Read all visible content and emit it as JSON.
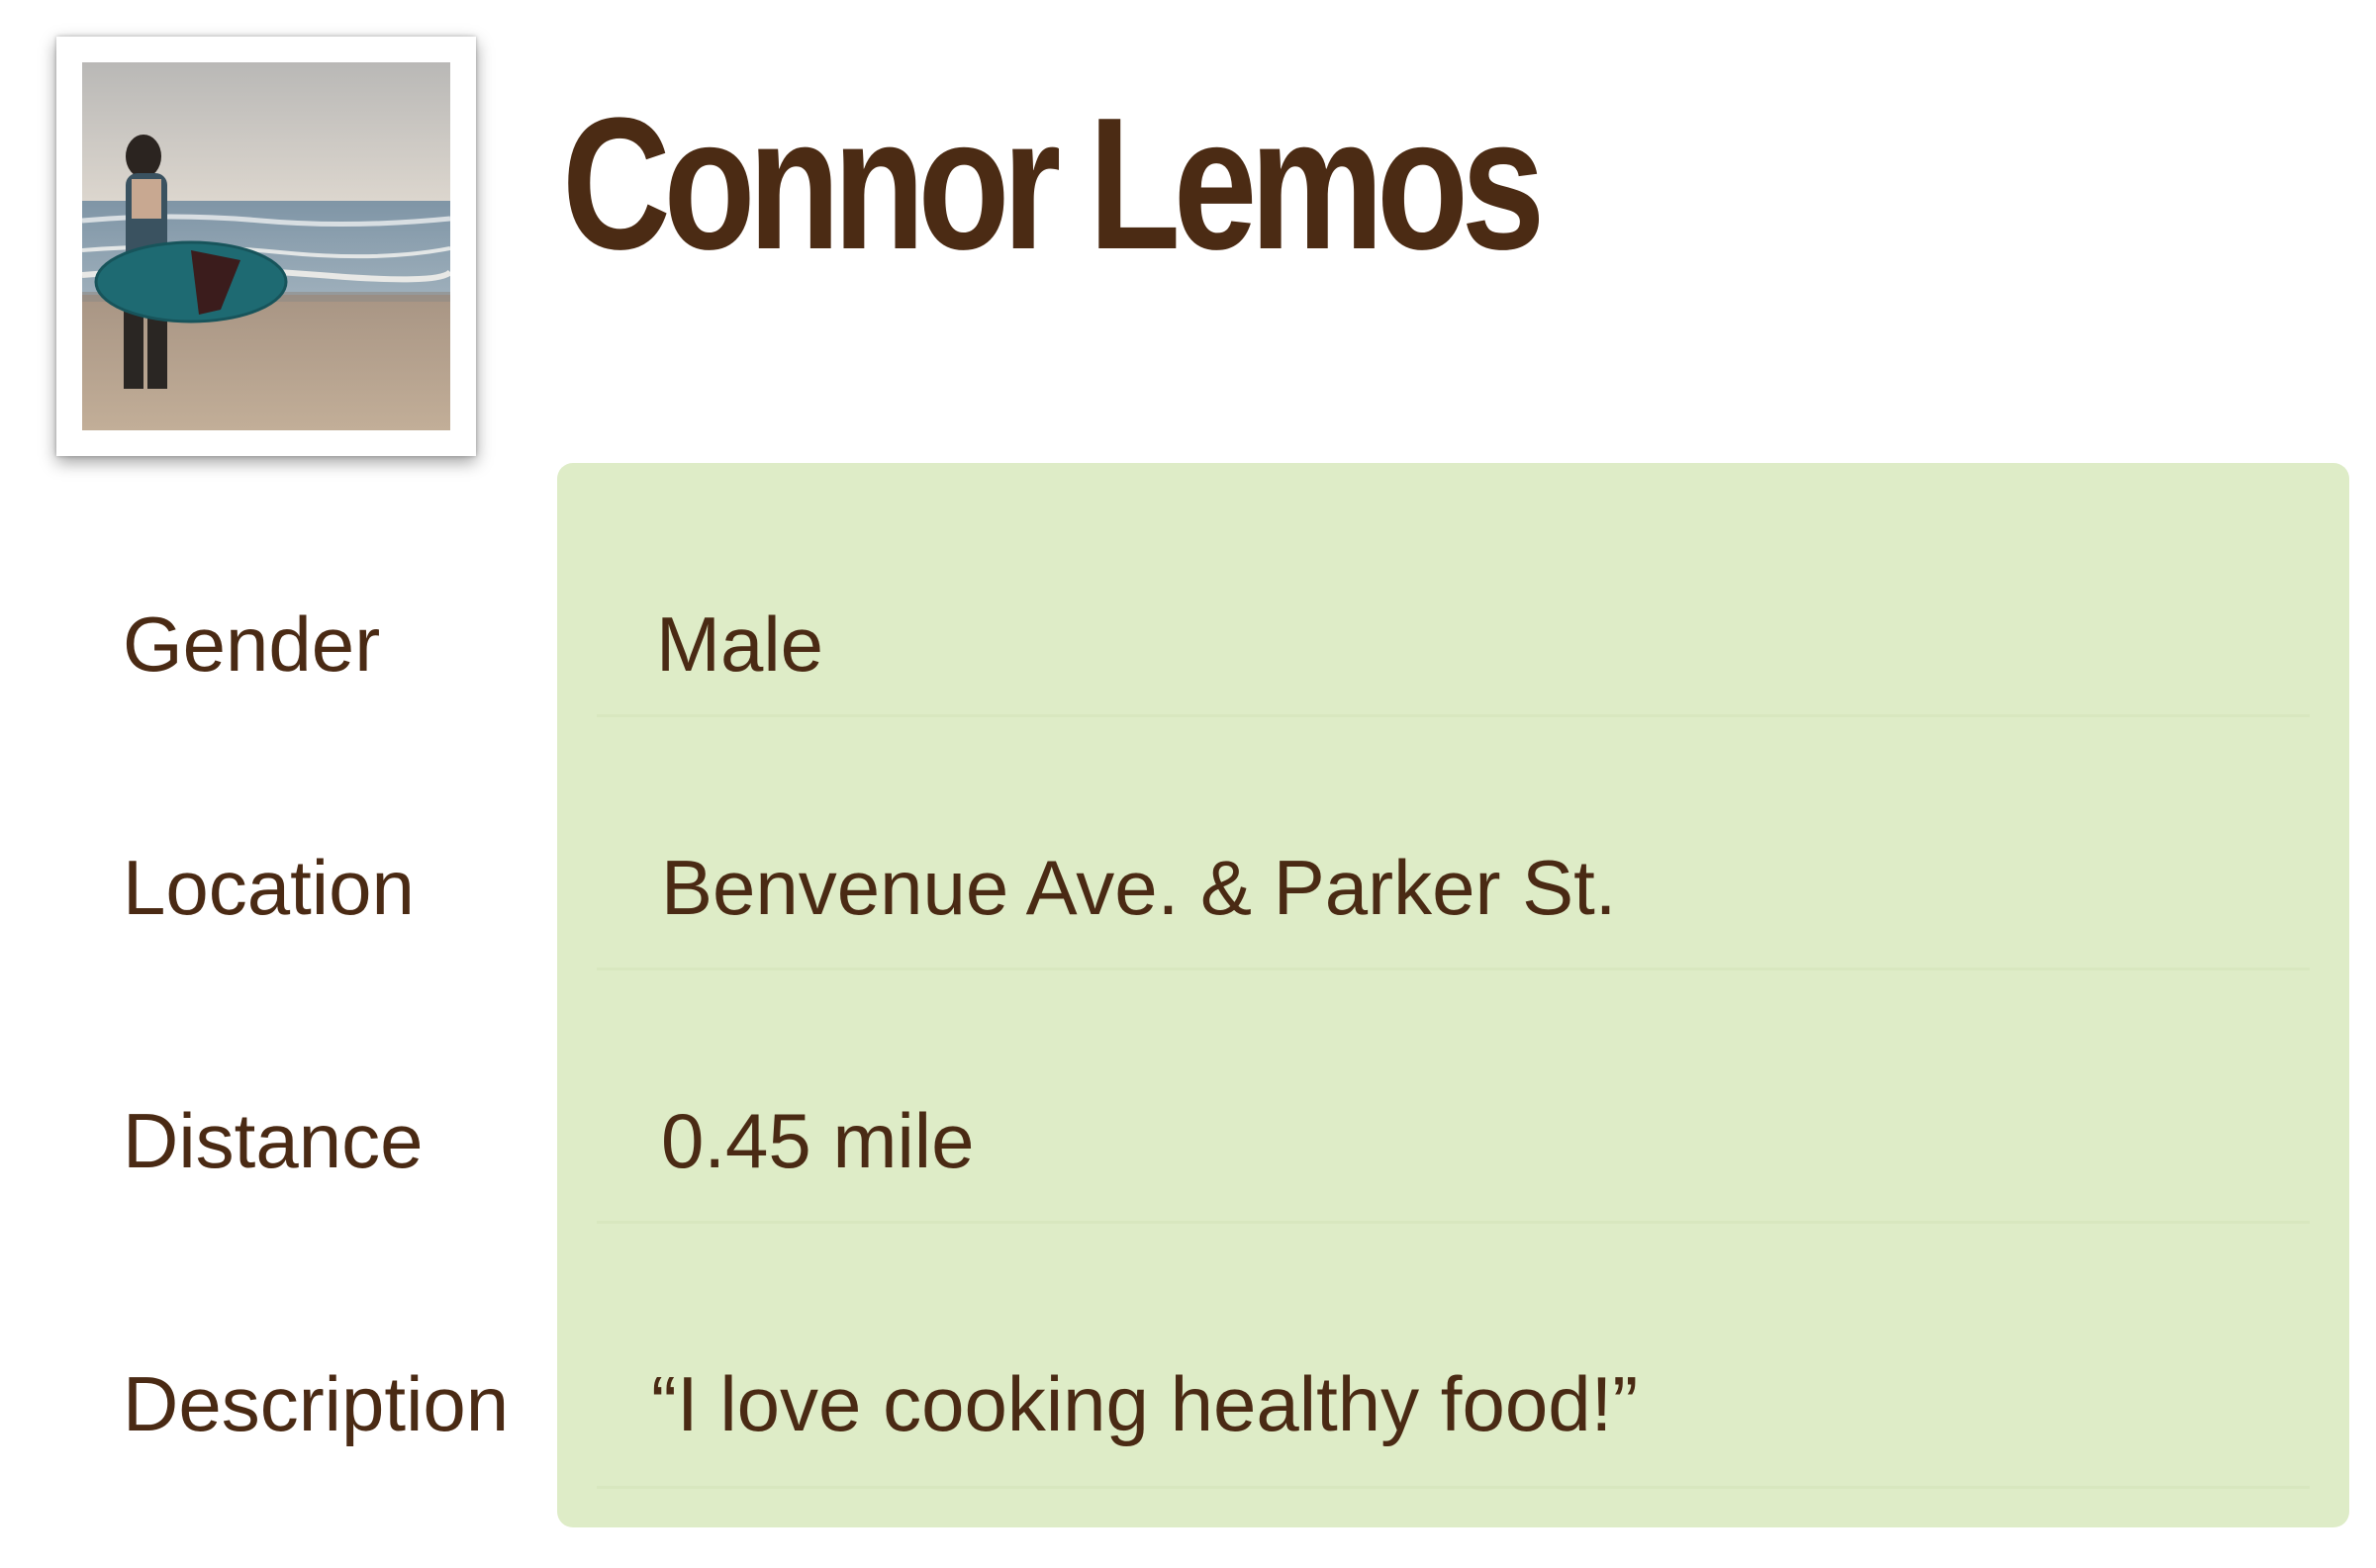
{
  "profile": {
    "name": "Connor Lemos",
    "photo_icon": "profile-photo-surfer",
    "fields": [
      {
        "label": "Gender",
        "value": "Male"
      },
      {
        "label": "Location",
        "value": "Benvenue Ave. & Parker St."
      },
      {
        "label": "Distance",
        "value": "0.45 mile"
      },
      {
        "label": "Description",
        "value": "“I love cooking healthy food!”"
      }
    ]
  },
  "colors": {
    "text": "#4a2a14",
    "panel_background": "#deecc7",
    "page_background": "#ffffff"
  }
}
